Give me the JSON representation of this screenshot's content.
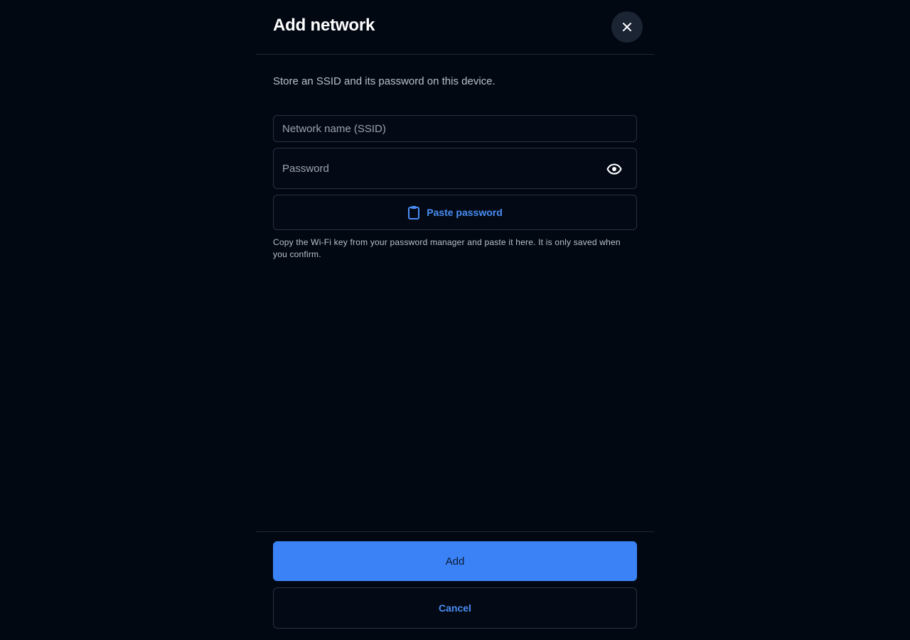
{
  "dialog": {
    "title": "Add network",
    "close_icon": "close-icon",
    "subtitle": "Store an SSID and its password on this device."
  },
  "form": {
    "ssid": {
      "value": "",
      "placeholder": "Network name (SSID)"
    },
    "password": {
      "value": "",
      "placeholder": "Password",
      "toggle_icon": "eye-icon"
    },
    "paste_button": {
      "label": "Paste password",
      "icon": "clipboard-icon"
    },
    "hint": "Copy the Wi-Fi key from your password manager and paste it here. It is only saved when you confirm."
  },
  "actions": {
    "primary_label": "Add",
    "secondary_label": "Cancel"
  },
  "colors": {
    "background": "#020812",
    "accent": "#3b82f6",
    "link": "#4a8df5",
    "border": "#283243",
    "close_button_bg": "#1b2433"
  }
}
